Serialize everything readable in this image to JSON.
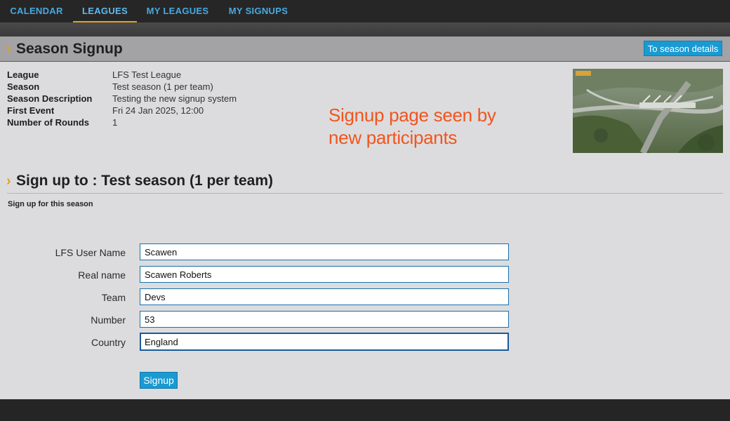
{
  "nav": {
    "tabs": [
      {
        "label": "CALENDAR"
      },
      {
        "label": "LEAGUES",
        "active": true
      },
      {
        "label": "MY LEAGUES"
      },
      {
        "label": "MY SIGNUPS"
      }
    ]
  },
  "header": {
    "chevron": "›",
    "title": "Season Signup",
    "details_button": "To season details"
  },
  "info": [
    {
      "label": "League",
      "value": "LFS Test League"
    },
    {
      "label": "Season",
      "value": "Test season (1 per team)"
    },
    {
      "label": "Season Description",
      "value": "Testing the new signup system"
    },
    {
      "label": "First Event",
      "value": "Fri 24 Jan 2025, 12:00"
    },
    {
      "label": "Number of Rounds",
      "value": "1"
    }
  ],
  "annotation": {
    "line1": "Signup page seen by",
    "line2": "new participants"
  },
  "thumbnail": {
    "icon": "track-aerial-image"
  },
  "signup": {
    "chevron": "›",
    "heading": "Sign up to : Test season (1 per team)",
    "subheading": "Sign up for this season",
    "fields": [
      {
        "label": "LFS User Name",
        "value": "Scawen"
      },
      {
        "label": "Real name",
        "value": "Scawen Roberts"
      },
      {
        "label": "Team",
        "value": "Devs"
      },
      {
        "label": "Number",
        "value": "53"
      },
      {
        "label": "Country",
        "value": "England",
        "focused": true
      }
    ],
    "button": "Signup"
  },
  "colors": {
    "nav_link": "#47a9e2",
    "active_underline": "#e3a21a",
    "button": "#1a9ad2",
    "annotation": "#f1551e",
    "background": "#dcdcde"
  }
}
